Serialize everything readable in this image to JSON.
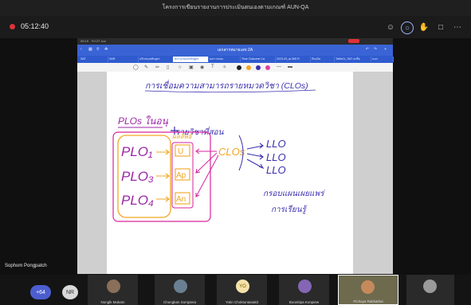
{
  "window": {
    "title": "โครงการเขียนรายงานการประเมินตนเองตามเกณฑ์ AUN-QA"
  },
  "meeting": {
    "timer": "05:12:40"
  },
  "toolbar_icons": [
    "people-icon",
    "chat-icon",
    "hand-icon",
    "share-icon",
    "more-icon"
  ],
  "ipad": {
    "time": "09:19",
    "date": "Fri 27 Jun"
  },
  "notebook": {
    "doc_title": "เอกสารหมายเลข 2A",
    "tabs": [
      "SAT",
      "SAR",
      "ปรับปรุงหลักสูตร",
      "สถานะของหลักสูตร",
      "ผลการสอบ",
      "Time Outcome Ca",
      "2023-03_ai-365 R",
      "ปัจจุบัน",
      "TaMe11_SAT ลงชื่อ",
      "นอก"
    ]
  },
  "board": {
    "title": "การเชื่อมความสามารถรายหมวดวิชา (CLOs)",
    "plos_heading": "PLOs ในอนุ",
    "courses_heading": "รายวิชาที่สอน",
    "plos": [
      "PLO₁",
      "PLO₃",
      "PLO₄"
    ],
    "sub_heading": "ผลลัพธ์",
    "domains": [
      "U",
      "Ap",
      "An"
    ],
    "clo": "CLOs",
    "llos": [
      "LLO",
      "LLO",
      "LLO"
    ],
    "note_line1": "กรอบแผนเผยแพร่",
    "note_line2": "การเรียนรู้"
  },
  "presenter": {
    "name": "Sophom Pongpatch"
  },
  "participants": {
    "more_count": "+64",
    "initials_pill": "NR",
    "tiles": [
      {
        "name": "Nonglk Mokam",
        "initials": ""
      },
      {
        "name": "Chongkan Sompiera",
        "initials": ""
      },
      {
        "name": "Yotin Choktuntanakit",
        "initials": "YO"
      },
      {
        "name": "Boonitipa Konpiew",
        "initials": ""
      },
      {
        "name": "Pichaya Rakkathai",
        "initials": ""
      },
      {
        "name": "",
        "initials": ""
      }
    ]
  },
  "colors": {
    "plo": "#9b27a6",
    "domain": "#f2a623",
    "arrow": "#3b2fb0",
    "accent": "#3a64d6"
  }
}
